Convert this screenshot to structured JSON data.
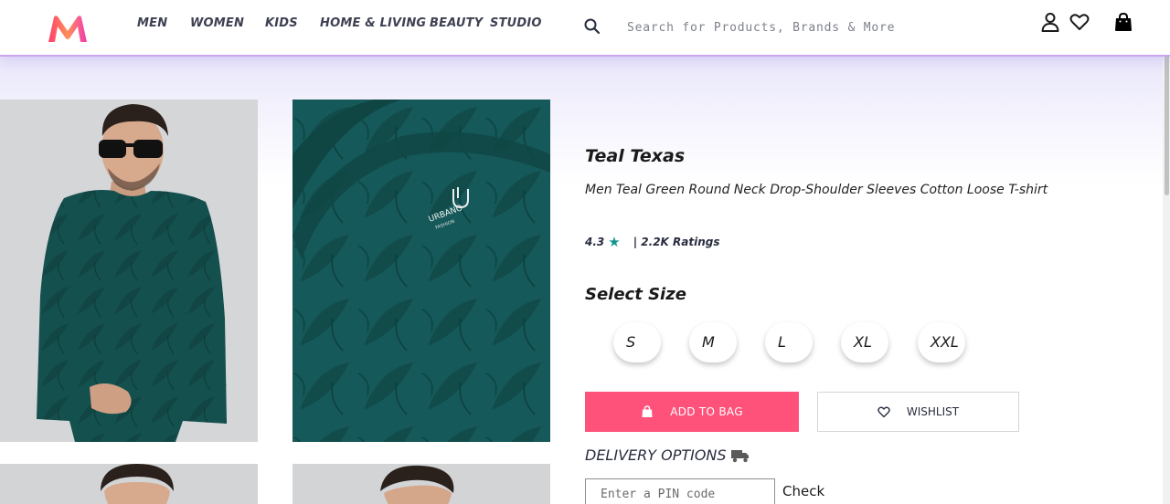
{
  "header": {
    "logo_icon": "myntra-logo-icon",
    "nav": [
      {
        "label": "MEN"
      },
      {
        "label": "WOMEN"
      },
      {
        "label": "KIDS"
      },
      {
        "label": "HOME & LIVING"
      },
      {
        "label": "BEAUTY"
      },
      {
        "label": "STUDIO"
      }
    ],
    "search_placeholder": "Search for Products, Brands & More",
    "icons": [
      "search-icon",
      "profile-icon",
      "heart-icon",
      "bag-icon"
    ]
  },
  "product": {
    "brand": "Teal Texas",
    "name": "Men Teal Green Round Neck Drop-Shoulder Sleeves Cotton Loose T-shirt",
    "rating": "4.3",
    "ratings_count": "| 2.2K Ratings",
    "images": [
      "model-front",
      "collar-closeup",
      "model-front-2",
      "model-side"
    ],
    "collar_label": "URBANO",
    "collar_label_sub": "FASHION"
  },
  "size": {
    "title": "Select Size",
    "options": [
      "S",
      "M",
      "L",
      "XL",
      "XXL"
    ]
  },
  "actions": {
    "add_to_bag": "ADD TO BAG",
    "wishlist": "WISHLIST"
  },
  "delivery": {
    "title": "DELIVERY OPTIONS",
    "pin_placeholder": "Enter a PIN code",
    "check": "Check"
  },
  "colors": {
    "accent": "#ff527b",
    "teal": "#14958f",
    "header_border": "#c9a5ec",
    "shirt": "#15514f"
  }
}
